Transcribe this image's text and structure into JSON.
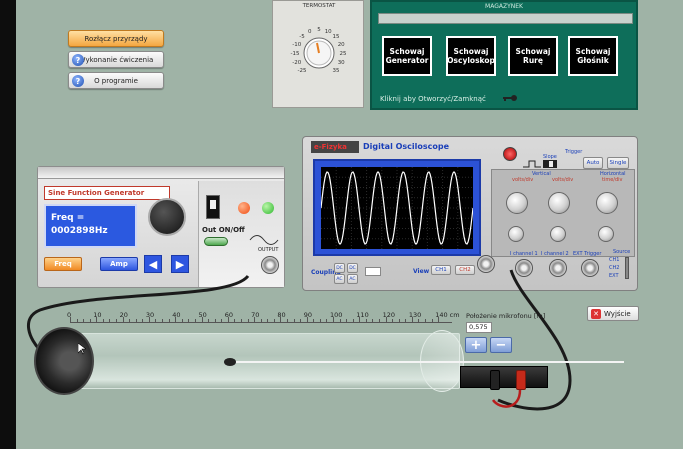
{
  "menu": {
    "items": [
      {
        "label": "Rozłącz przyrządy",
        "icon": ""
      },
      {
        "label": "Wykonanie ćwiczenia",
        "icon": "help-icon"
      },
      {
        "label": "O programie",
        "icon": "help-icon"
      }
    ]
  },
  "thermostat": {
    "title": "TERMOSTAT",
    "scale": [
      "-25",
      "-20",
      "-15",
      "-10",
      "-5",
      "0",
      "5",
      "10",
      "15",
      "20",
      "25",
      "30",
      "35"
    ]
  },
  "magazyn": {
    "title": "MAGAZYNEK",
    "buttons": [
      "Schowaj Generator",
      "Schowaj Oscyloskop",
      "Schowaj Rurę",
      "Schowaj Głośnik"
    ],
    "hint": "Kliknij aby Otworzyć/Zamknąć"
  },
  "generator": {
    "title": "Sine Function Generator",
    "freq_label": "Freq =",
    "freq_value": "0002898Hz",
    "freq_btn": "Freq",
    "amp_btn": "Amp",
    "out_label": "Out ON/Off",
    "output_label": "OUTPUT"
  },
  "oscilloscope": {
    "logo": "e-Fizyka",
    "title": "Digital Osciloscope",
    "trigger": "Trigger",
    "slope": "Slope",
    "auto": "Auto",
    "single": "Single",
    "vertical": "Vertical",
    "volts_div": "volts/div",
    "horizontal": "Horizontal",
    "time_div": "time/div",
    "coupling": "Coupling",
    "view": "View",
    "ch1": "CH1",
    "ch2": "CH2",
    "coupling_opts": [
      "DC",
      "AC",
      "DC",
      "AC"
    ],
    "ext_trigger": "EXT Trigger",
    "ch1_label": "I channel 1",
    "ch2_label": "I channel 2",
    "source": "Source",
    "source_opts": [
      "CH1",
      "CH2",
      "EXT"
    ],
    "wave_cycles": 6
  },
  "tube": {
    "ruler_ticks": [
      "0",
      "10",
      "20",
      "30",
      "40",
      "50",
      "60",
      "70",
      "80",
      "90",
      "100",
      "110",
      "120",
      "130",
      "140 cm"
    ]
  },
  "position": {
    "label": "Położenie mikrofonu [m]",
    "value": "0,575",
    "plus": "+",
    "minus": "−"
  },
  "exit": {
    "label": "Wyjście"
  },
  "colors": {
    "background": "#9fb3a6",
    "magazyn": "#0e6e5a",
    "lcd": "#2b59e0",
    "trace": "#ffffff"
  }
}
